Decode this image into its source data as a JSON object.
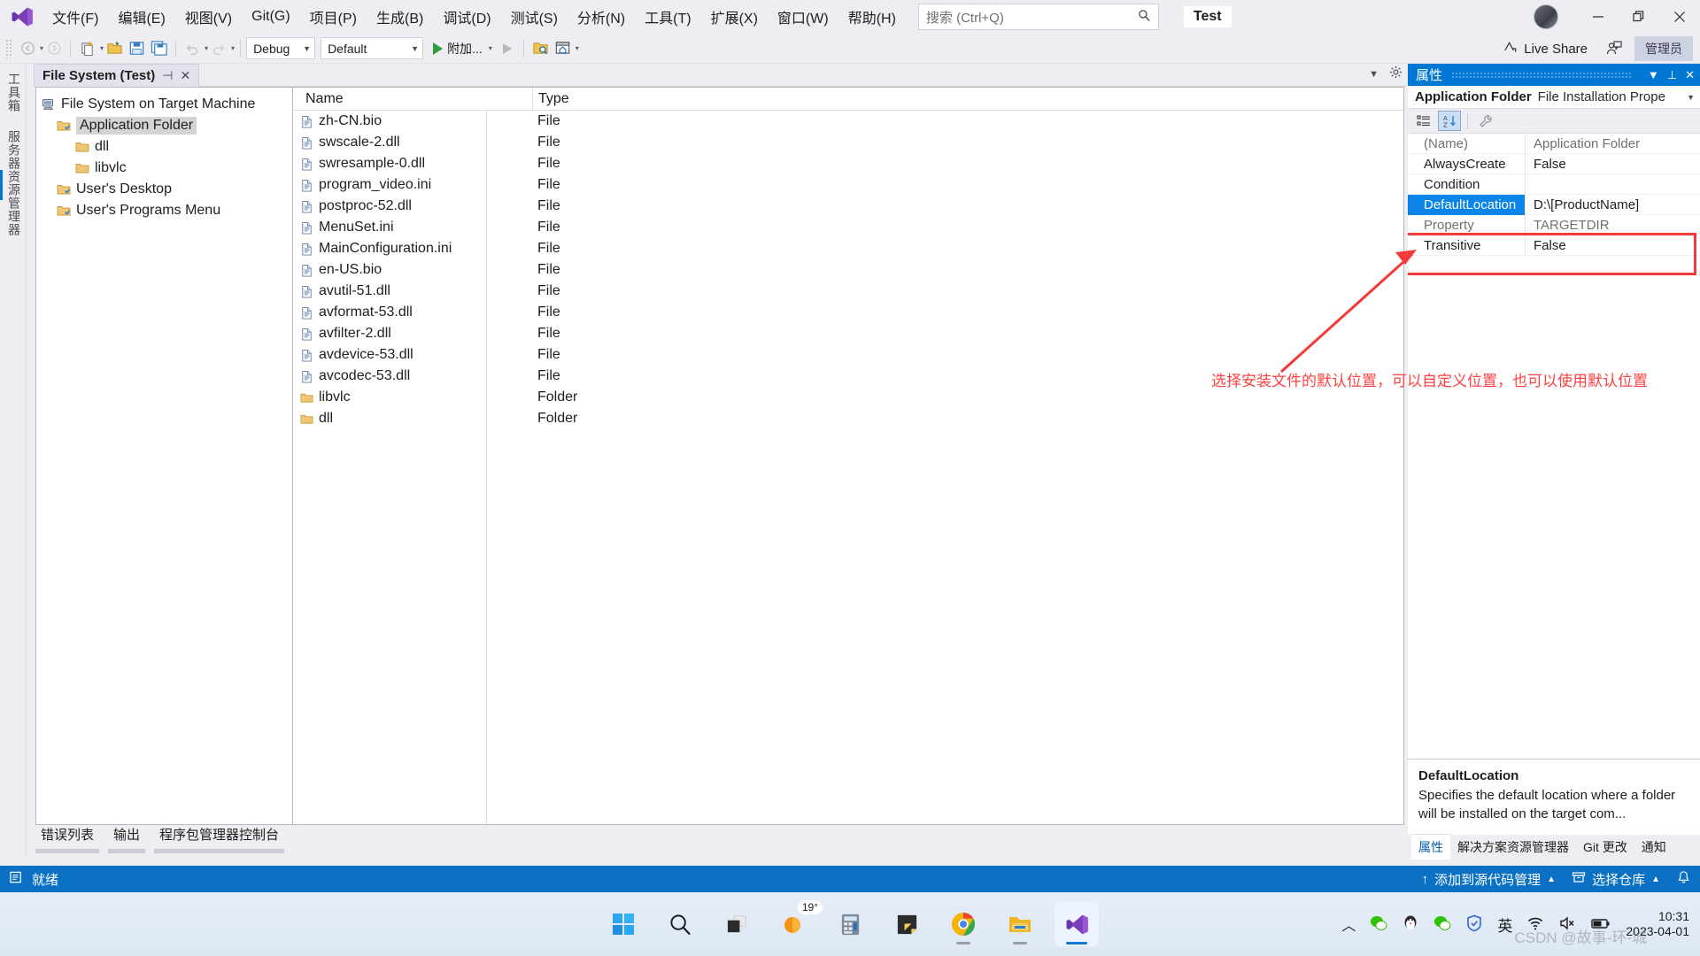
{
  "menubar": {
    "logo": "visual-studio-logo",
    "items": [
      {
        "label": "文件(F)"
      },
      {
        "label": "编辑(E)"
      },
      {
        "label": "视图(V)"
      },
      {
        "label": "Git(G)"
      },
      {
        "label": "项目(P)"
      },
      {
        "label": "生成(B)"
      },
      {
        "label": "调试(D)"
      },
      {
        "label": "测试(S)"
      },
      {
        "label": "分析(N)"
      },
      {
        "label": "工具(T)"
      },
      {
        "label": "扩展(X)"
      },
      {
        "label": "窗口(W)"
      },
      {
        "label": "帮助(H)"
      }
    ],
    "search_placeholder": "搜索 (Ctrl+Q)",
    "window_title": "Test",
    "window_controls": {
      "minimize": "–",
      "restore": "❐",
      "close": "✕"
    }
  },
  "toolbar": {
    "back": "◀",
    "forward": "▶",
    "config_combo": "Debug",
    "platform_combo": "Default",
    "run_label": "附加...",
    "live_share": "Live Share",
    "admin_badge": "管理员"
  },
  "vertical_tabs": [
    {
      "label": "工具箱"
    },
    {
      "label": "服务器资源管理器"
    }
  ],
  "document_tab": {
    "title": "File System (Test)",
    "pin": "⊣",
    "close": "✕"
  },
  "tree": {
    "root": {
      "label": "File System on Target Machine",
      "icon": "computer-icon"
    },
    "nodes": [
      {
        "label": "Application Folder",
        "icon": "special-folder-icon",
        "indent": 1,
        "selected": true
      },
      {
        "label": "dll",
        "icon": "folder-icon",
        "indent": 2,
        "selected": false
      },
      {
        "label": "libvlc",
        "icon": "folder-icon",
        "indent": 2,
        "selected": false
      },
      {
        "label": "User's Desktop",
        "icon": "special-folder-icon",
        "indent": 1,
        "selected": false
      },
      {
        "label": "User's Programs Menu",
        "icon": "special-folder-icon",
        "indent": 1,
        "selected": false
      }
    ]
  },
  "filelist": {
    "columns": [
      "Name",
      "Type"
    ],
    "rows": [
      {
        "name": "zh-CN.bio",
        "type": "File",
        "icon": "file-icon"
      },
      {
        "name": "swscale-2.dll",
        "type": "File",
        "icon": "file-icon"
      },
      {
        "name": "swresample-0.dll",
        "type": "File",
        "icon": "file-icon"
      },
      {
        "name": "program_video.ini",
        "type": "File",
        "icon": "file-icon"
      },
      {
        "name": "postproc-52.dll",
        "type": "File",
        "icon": "file-icon"
      },
      {
        "name": "MenuSet.ini",
        "type": "File",
        "icon": "file-icon"
      },
      {
        "name": "MainConfiguration.ini",
        "type": "File",
        "icon": "file-icon"
      },
      {
        "name": "en-US.bio",
        "type": "File",
        "icon": "file-icon"
      },
      {
        "name": "avutil-51.dll",
        "type": "File",
        "icon": "file-icon"
      },
      {
        "name": "avformat-53.dll",
        "type": "File",
        "icon": "file-icon"
      },
      {
        "name": "avfilter-2.dll",
        "type": "File",
        "icon": "file-icon"
      },
      {
        "name": "avdevice-53.dll",
        "type": "File",
        "icon": "file-icon"
      },
      {
        "name": "avcodec-53.dll",
        "type": "File",
        "icon": "file-icon"
      },
      {
        "name": "libvlc",
        "type": "Folder",
        "icon": "folder-icon"
      },
      {
        "name": "dll",
        "type": "Folder",
        "icon": "folder-icon"
      }
    ]
  },
  "bottom_tool_tabs": [
    {
      "label": "错误列表"
    },
    {
      "label": "输出"
    },
    {
      "label": "程序包管理器控制台"
    }
  ],
  "properties": {
    "title": "属性",
    "object_name": "Application Folder",
    "object_type": "File Installation Prope",
    "toolbar": {
      "categorized": "categorized-icon",
      "alphabetical": "alphabetical-sort-icon",
      "property_pages": "wrench-icon"
    },
    "rows": [
      {
        "key": "(Name)",
        "value": "Application Folder",
        "dim": true,
        "selected": false
      },
      {
        "key": "AlwaysCreate",
        "value": "False",
        "dim": false,
        "selected": false
      },
      {
        "key": "Condition",
        "value": "",
        "dim": false,
        "selected": false
      },
      {
        "key": "DefaultLocation",
        "value": "D:\\[ProductName]",
        "dim": false,
        "selected": true
      },
      {
        "key": "Property",
        "value": "TARGETDIR",
        "dim": true,
        "selected": false
      },
      {
        "key": "Transitive",
        "value": "False",
        "dim": false,
        "selected": false
      }
    ],
    "description": {
      "title": "DefaultLocation",
      "text": "Specifies the default location where a folder will be installed on the target com..."
    },
    "tabs": [
      {
        "label": "属性",
        "active": true
      },
      {
        "label": "解决方案资源管理器",
        "active": false
      },
      {
        "label": "Git 更改",
        "active": false
      },
      {
        "label": "通知",
        "active": false
      }
    ]
  },
  "annotation": {
    "text": "选择安装文件的默认位置，可以自定义位置，也可以使用默认位置",
    "color": "#ff4040"
  },
  "status_bar": {
    "ready": "就绪",
    "source_control": "添加到源代码管理",
    "repository": "选择仓库",
    "notifications_icon": "bell-icon"
  },
  "taskbar": {
    "icons": [
      {
        "name": "start-windows-icon"
      },
      {
        "name": "search-icon"
      },
      {
        "name": "task-view-icon"
      },
      {
        "name": "weather-icon",
        "badge": "19°"
      },
      {
        "name": "calculator-icon"
      },
      {
        "name": "sticky-notes-icon"
      },
      {
        "name": "chrome-icon",
        "running": true
      },
      {
        "name": "file-explorer-icon",
        "running": true
      },
      {
        "name": "visual-studio-icon",
        "running": true,
        "active": true
      }
    ],
    "tray": [
      {
        "name": "show-hidden-icons-chevron"
      },
      {
        "name": "wechat-icon"
      },
      {
        "name": "qq-icon"
      },
      {
        "name": "wechat-work-icon"
      },
      {
        "name": "tencent-security-icon"
      },
      {
        "name": "ime-indicator",
        "label": "英"
      },
      {
        "name": "wifi-icon"
      },
      {
        "name": "volume-muted-icon"
      },
      {
        "name": "battery-icon"
      }
    ],
    "clock_time": "10:31",
    "clock_date": "2023-04-01",
    "watermark": "CSDN @故事-环-城"
  }
}
